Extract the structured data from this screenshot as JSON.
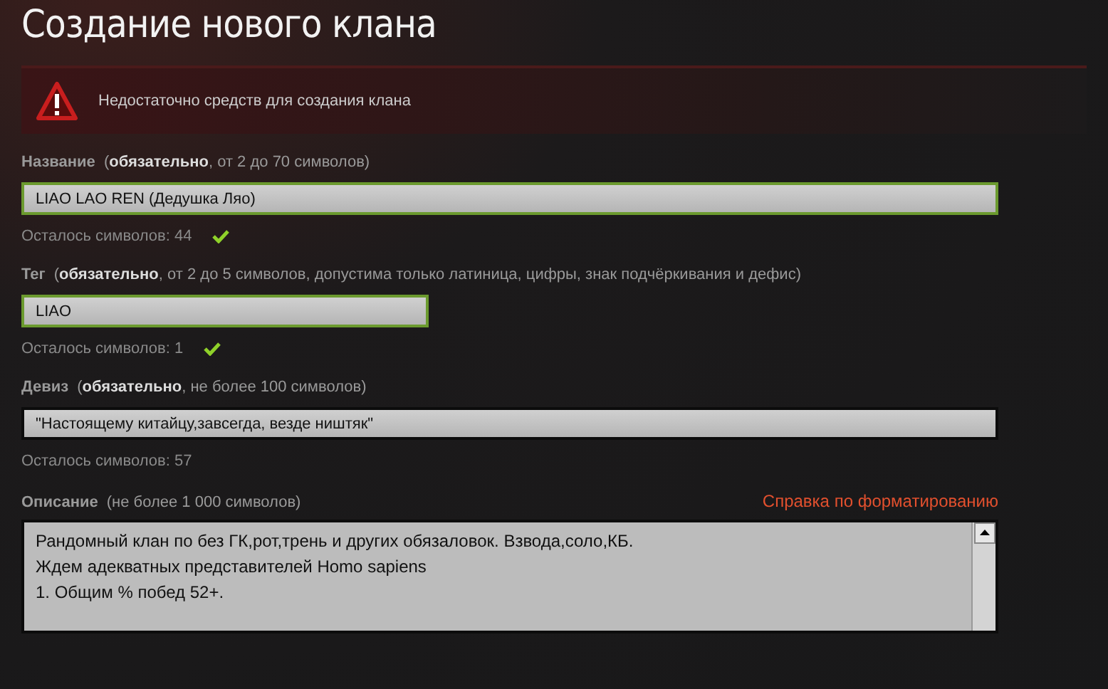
{
  "title": "Создание нового клана",
  "alert": {
    "text": "Недостаточно средств для создания клана"
  },
  "fields": [
    {
      "kind": "input",
      "label": "Название",
      "hint": "(**обязательно**, от 2 до 70 символов)",
      "value": "LIAO LAO REN (Дедушка Ляо)",
      "valid": true,
      "remaining": "Осталось символов: 44"
    },
    {
      "kind": "short-input",
      "label": "Тег",
      "hint": "(**обязательно**, от 2 до 5 символов, допустима только латиница, цифры, знак подчёркивания и дефис)",
      "value": "LIAO",
      "valid": true,
      "remaining": "Осталось символов: 1"
    },
    {
      "kind": "input",
      "label": "Девиз",
      "hint": "(**обязательно**, не более 100 символов)",
      "value": "\"Настоящему китайцу,завсегда, везде ништяк\"",
      "valid": false,
      "remaining": "Осталось символов: 57"
    },
    {
      "kind": "textarea",
      "label": "Описание",
      "hint": "(не более 1 000 символов)",
      "link": "Справка по форматированию",
      "valid": false,
      "lines": [
        "Рандомный клан по  без ГК,рот,трень и других обязаловок. Взвода,соло,КБ.",
        "Ждем адекватных представителей Homo sapiens",
        "1. Общим % побед 52+."
      ]
    }
  ]
}
